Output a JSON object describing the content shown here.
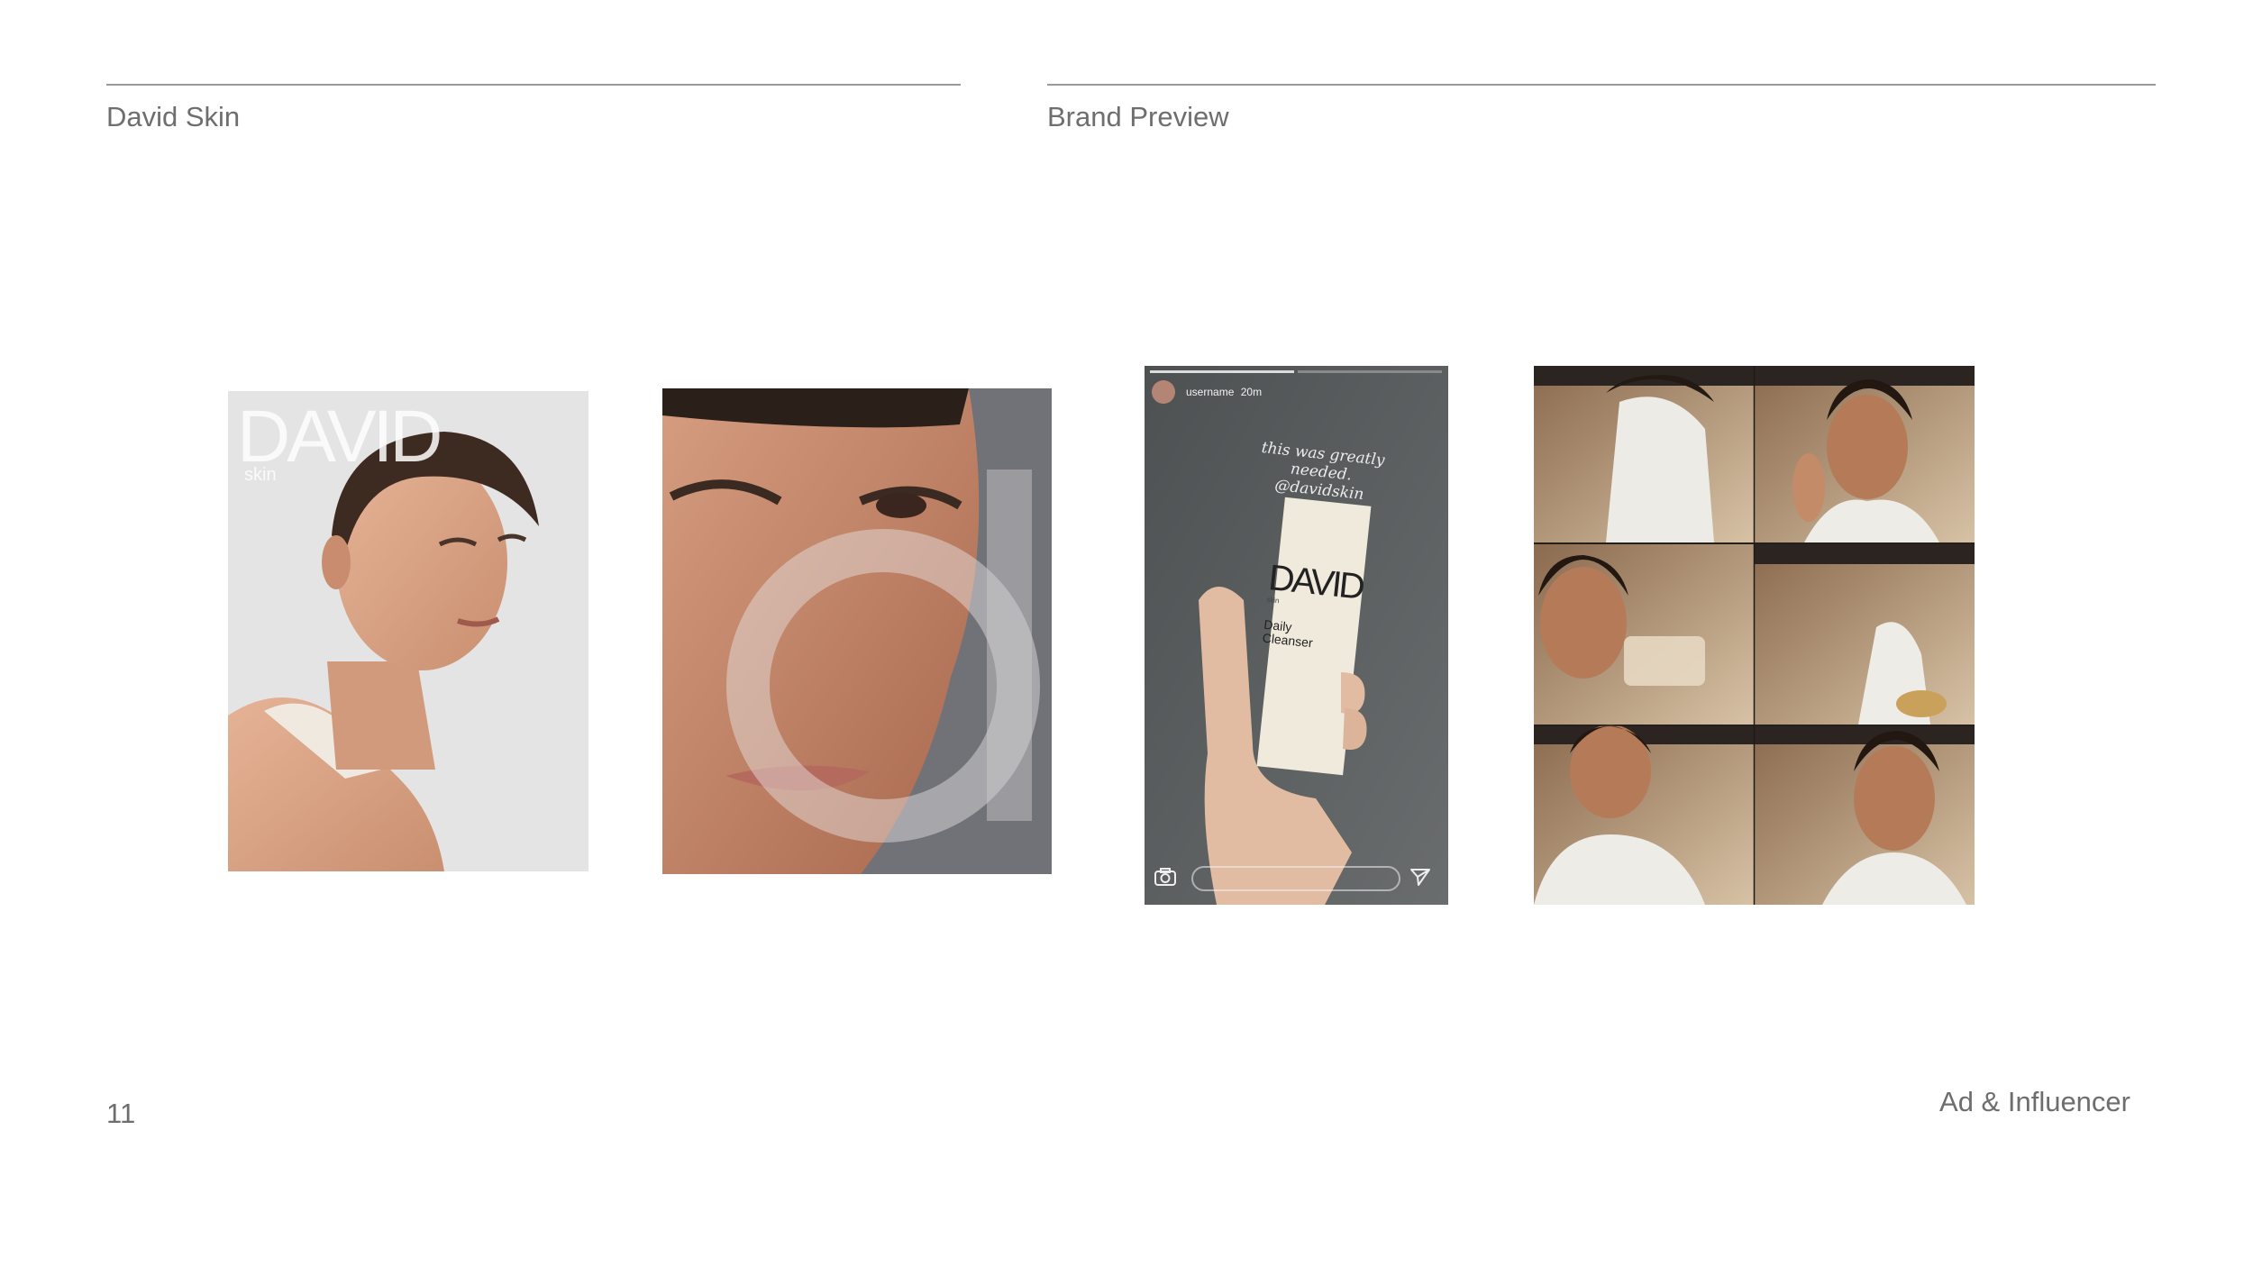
{
  "header": {
    "left_title": "David Skin",
    "right_title": "Brand Preview"
  },
  "footer": {
    "page_number": "11",
    "section_label": "Ad & Influencer"
  },
  "panels": {
    "cover": {
      "brand": "DAVID",
      "brand_sub": "skin"
    },
    "story": {
      "username": "username",
      "time": "20m",
      "caption_line1": "this was greatly needed.",
      "caption_line2": "@davidskin",
      "product_brand": "DAVID",
      "product_brand_sub": "skin",
      "product_name_line1": "Daily",
      "product_name_line2": "Cleanser"
    }
  },
  "icons": {
    "camera": "camera-icon",
    "send": "send-icon"
  }
}
